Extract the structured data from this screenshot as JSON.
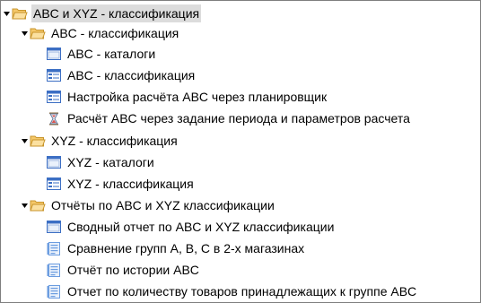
{
  "tree": {
    "root": {
      "label": "ABC и  XYZ - классификация",
      "icon": "folder-open-icon",
      "expanded": true
    },
    "groups": [
      {
        "label": "ABC - классификация",
        "icon": "folder-open-icon",
        "expanded": true,
        "items": [
          {
            "label": "ABC - каталоги",
            "icon": "catalog-window-icon"
          },
          {
            "label": "ABC - классификация",
            "icon": "form-icon"
          },
          {
            "label": "Настройка расчёта ABC через планировщик",
            "icon": "form-icon"
          },
          {
            "label": "Расчёт ABC через задание периода и параметров расчета",
            "icon": "hourglass-icon"
          }
        ]
      },
      {
        "label": "XYZ - классификация",
        "icon": "folder-open-icon",
        "expanded": true,
        "items": [
          {
            "label": "XYZ - каталоги",
            "icon": "catalog-window-icon"
          },
          {
            "label": "XYZ - классификация",
            "icon": "form-icon"
          }
        ]
      },
      {
        "label": "Отчёты по ABC и XYZ классификации",
        "icon": "folder-open-icon",
        "expanded": true,
        "items": [
          {
            "label": "Сводный отчет по ABC и XYZ классификации",
            "icon": "catalog-window-icon"
          },
          {
            "label": "Сравнение групп A, B, C в 2-х магазинах",
            "icon": "report-icon"
          },
          {
            "label": "Отчёт по истории ABC",
            "icon": "report-icon"
          },
          {
            "label": "Отчет по количеству товаров принадлежащих к группе ABC",
            "icon": "report-icon"
          }
        ]
      }
    ]
  },
  "colors": {
    "folder": "#f5c86a",
    "folder_edge": "#c8952c",
    "window_blue": "#3c6fc4",
    "report_blue": "#6c9de0",
    "selection": "#dcdcdc"
  }
}
